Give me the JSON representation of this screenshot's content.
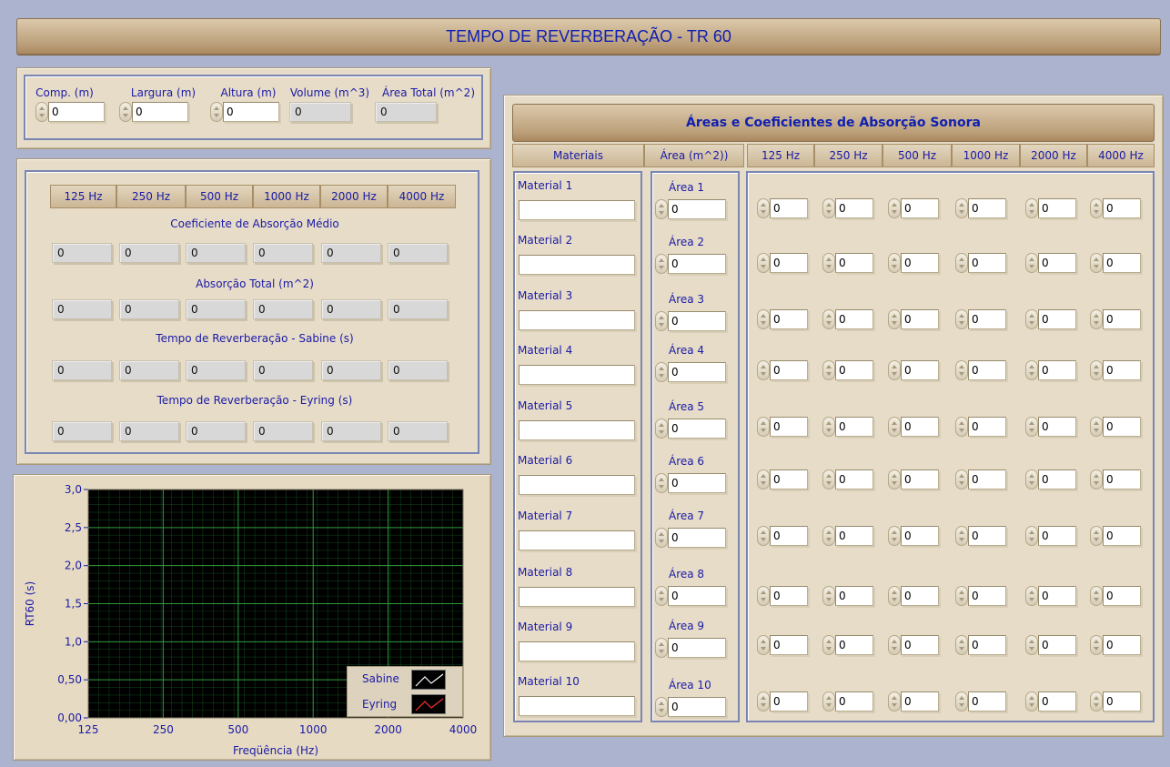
{
  "title": "TEMPO DE REVERBERAÇÃO - TR 60",
  "dimensions": {
    "labels": [
      "Comp. (m)",
      "Largura (m)",
      "Altura (m)",
      "Volume (m^3)",
      "Área Total (m^2)"
    ],
    "values": [
      "0",
      "0",
      "0",
      "0",
      "0"
    ]
  },
  "frequencies": [
    "125 Hz",
    "250 Hz",
    "500 Hz",
    "1000 Hz",
    "2000 Hz",
    "4000 Hz"
  ],
  "results": {
    "sections": [
      {
        "label": "Coeficiente de Absorção Médio",
        "values": [
          "0",
          "0",
          "0",
          "0",
          "0",
          "0"
        ]
      },
      {
        "label": "Absorção  Total (m^2)",
        "values": [
          "0",
          "0",
          "0",
          "0",
          "0",
          "0"
        ]
      },
      {
        "label": "Tempo de Reverberação - Sabine (s)",
        "values": [
          "0",
          "0",
          "0",
          "0",
          "0",
          "0"
        ]
      },
      {
        "label": "Tempo de Reverberação - Eyring (s)",
        "values": [
          "0",
          "0",
          "0",
          "0",
          "0",
          "0"
        ]
      }
    ]
  },
  "absorption_table": {
    "title": "Áreas e Coeficientes de Absorção Sonora",
    "col_materials": "Materiais",
    "col_area": "Área (m^2))",
    "materials": [
      "Material 1",
      "Material 2",
      "Material 3",
      "Material 4",
      "Material 5",
      "Material 6",
      "Material 7",
      "Material 8",
      "Material 9",
      "Material 10"
    ],
    "material_values": [
      "",
      "",
      "",
      "",
      "",
      "",
      "",
      "",
      "",
      ""
    ],
    "areas": [
      "Área 1",
      "Área 2",
      "Área 3",
      "Área 4",
      "Área 5",
      "Área 6",
      "Área 7",
      "Área 8",
      "Área 9",
      "Área 10"
    ],
    "area_values": [
      "0",
      "0",
      "0",
      "0",
      "0",
      "0",
      "0",
      "0",
      "0",
      "0"
    ],
    "coef_values": [
      [
        "0",
        "0",
        "0",
        "0",
        "0",
        "0"
      ],
      [
        "0",
        "0",
        "0",
        "0",
        "0",
        "0"
      ],
      [
        "0",
        "0",
        "0",
        "0",
        "0",
        "0"
      ],
      [
        "0",
        "0",
        "0",
        "0",
        "0",
        "0"
      ],
      [
        "0",
        "0",
        "0",
        "0",
        "0",
        "0"
      ],
      [
        "0",
        "0",
        "0",
        "0",
        "0",
        "0"
      ],
      [
        "0",
        "0",
        "0",
        "0",
        "0",
        "0"
      ],
      [
        "0",
        "0",
        "0",
        "0",
        "0",
        "0"
      ],
      [
        "0",
        "0",
        "0",
        "0",
        "0",
        "0"
      ],
      [
        "0",
        "0",
        "0",
        "0",
        "0",
        "0"
      ]
    ]
  },
  "chart_data": {
    "type": "line",
    "xlabel": "Freqüência (Hz)",
    "ylabel": "RT60 (s)",
    "x_ticks": [
      "125",
      "250",
      "500",
      "1000",
      "2000",
      "4000"
    ],
    "y_ticks": [
      "0,00",
      "0,50",
      "1,0",
      "1,5",
      "2,0",
      "2,5",
      "3,0"
    ],
    "ylim": [
      0,
      3
    ],
    "x_scale": "log",
    "xlim": [
      125,
      4000
    ],
    "grid": true,
    "background": "#000000",
    "grid_color": "#1f6b2c",
    "legend_position": "bottom-right",
    "series": [
      {
        "name": "Sabine",
        "color": "#ffffff",
        "values": []
      },
      {
        "name": "Eyring",
        "color": "#ff3030",
        "values": []
      }
    ]
  }
}
